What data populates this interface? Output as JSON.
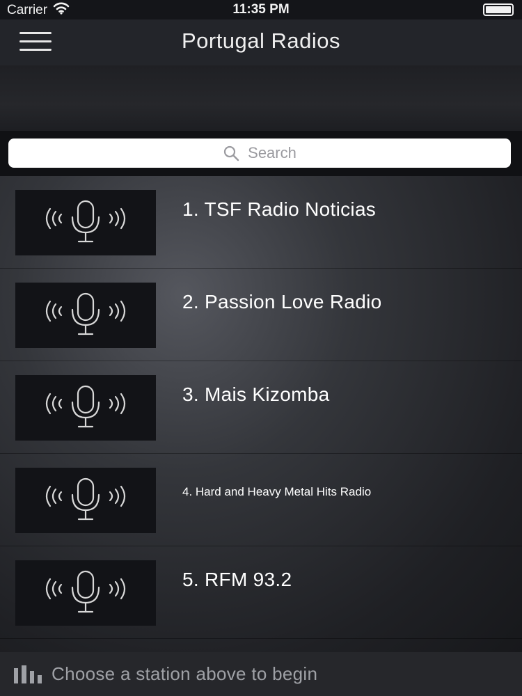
{
  "status_bar": {
    "carrier": "Carrier",
    "time": "11:35 PM"
  },
  "nav": {
    "title": "Portugal Radios"
  },
  "search": {
    "placeholder": "Search"
  },
  "stations": [
    {
      "label": "1. TSF Radio Noticias",
      "size": "large"
    },
    {
      "label": "2. Passion Love Radio",
      "size": "large"
    },
    {
      "label": "3. Mais Kizomba",
      "size": "large"
    },
    {
      "label": "4. Hard and Heavy Metal Hits Radio",
      "size": "small"
    },
    {
      "label": "5. RFM 93.2",
      "size": "large"
    }
  ],
  "footer": {
    "text": "Choose a station above to begin"
  },
  "icons": {
    "menu": "hamburger-menu-icon",
    "search": "search-icon",
    "station": "microphone-broadcast-icon",
    "footer": "equalizer-bars-icon",
    "wifi": "wifi-icon",
    "battery": "battery-icon"
  },
  "colors": {
    "navbar": "#23252a",
    "statusbar": "#141519",
    "search_box": "#ffffff",
    "footer": "#26272b",
    "footer_text": "#9fa1a6"
  }
}
